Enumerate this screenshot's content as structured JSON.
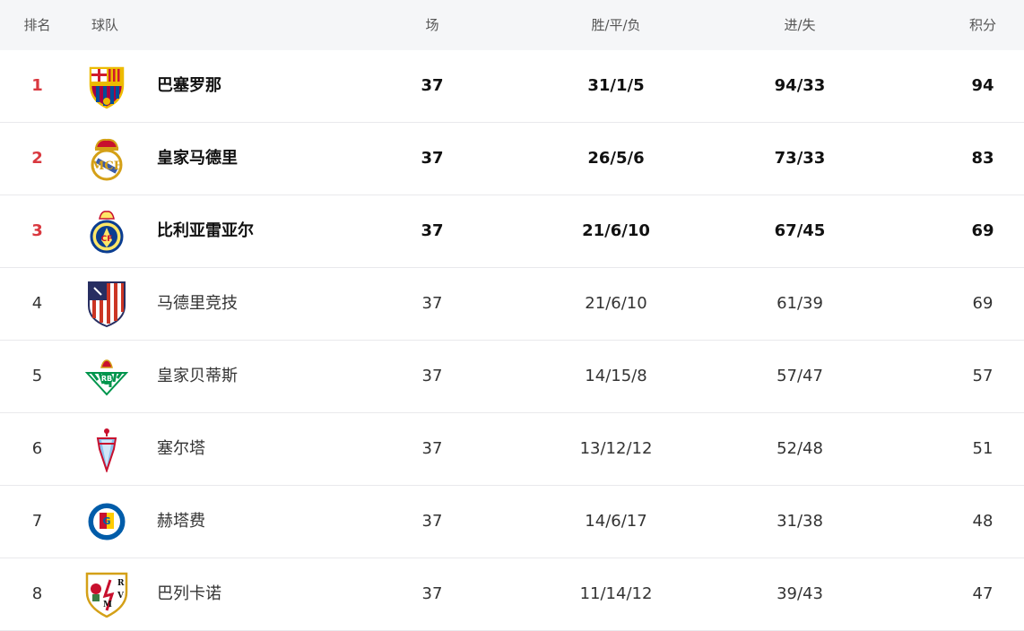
{
  "header": {
    "rank": "排名",
    "team": "球队",
    "played": "场",
    "wdl": "胜/平/负",
    "goals": "进/失",
    "points": "积分"
  },
  "rows": [
    {
      "rank": "1",
      "team": "巴塞罗那",
      "played": "37",
      "wdl": "31/1/5",
      "goals": "94/33",
      "points": "94",
      "logo": "barcelona-crest-icon"
    },
    {
      "rank": "2",
      "team": "皇家马德里",
      "played": "37",
      "wdl": "26/5/6",
      "goals": "73/33",
      "points": "83",
      "logo": "real-madrid-crest-icon"
    },
    {
      "rank": "3",
      "team": "比利亚雷亚尔",
      "played": "37",
      "wdl": "21/6/10",
      "goals": "67/45",
      "points": "69",
      "logo": "villarreal-crest-icon"
    },
    {
      "rank": "4",
      "team": "马德里竞技",
      "played": "37",
      "wdl": "21/6/10",
      "goals": "61/39",
      "points": "69",
      "logo": "atletico-madrid-crest-icon"
    },
    {
      "rank": "5",
      "team": "皇家贝蒂斯",
      "played": "37",
      "wdl": "14/15/8",
      "goals": "57/47",
      "points": "57",
      "logo": "real-betis-crest-icon"
    },
    {
      "rank": "6",
      "team": "塞尔塔",
      "played": "37",
      "wdl": "13/12/12",
      "goals": "52/48",
      "points": "51",
      "logo": "celta-vigo-crest-icon"
    },
    {
      "rank": "7",
      "team": "赫塔费",
      "played": "37",
      "wdl": "14/6/17",
      "goals": "31/38",
      "points": "48",
      "logo": "getafe-crest-icon"
    },
    {
      "rank": "8",
      "team": "巴列卡诺",
      "played": "37",
      "wdl": "11/14/12",
      "goals": "39/43",
      "points": "47",
      "logo": "rayo-vallecano-crest-icon"
    }
  ],
  "colors": {
    "top_rank": "#d9383f",
    "header_bg": "#f5f6f8",
    "row_divider": "#e9e9ec"
  }
}
